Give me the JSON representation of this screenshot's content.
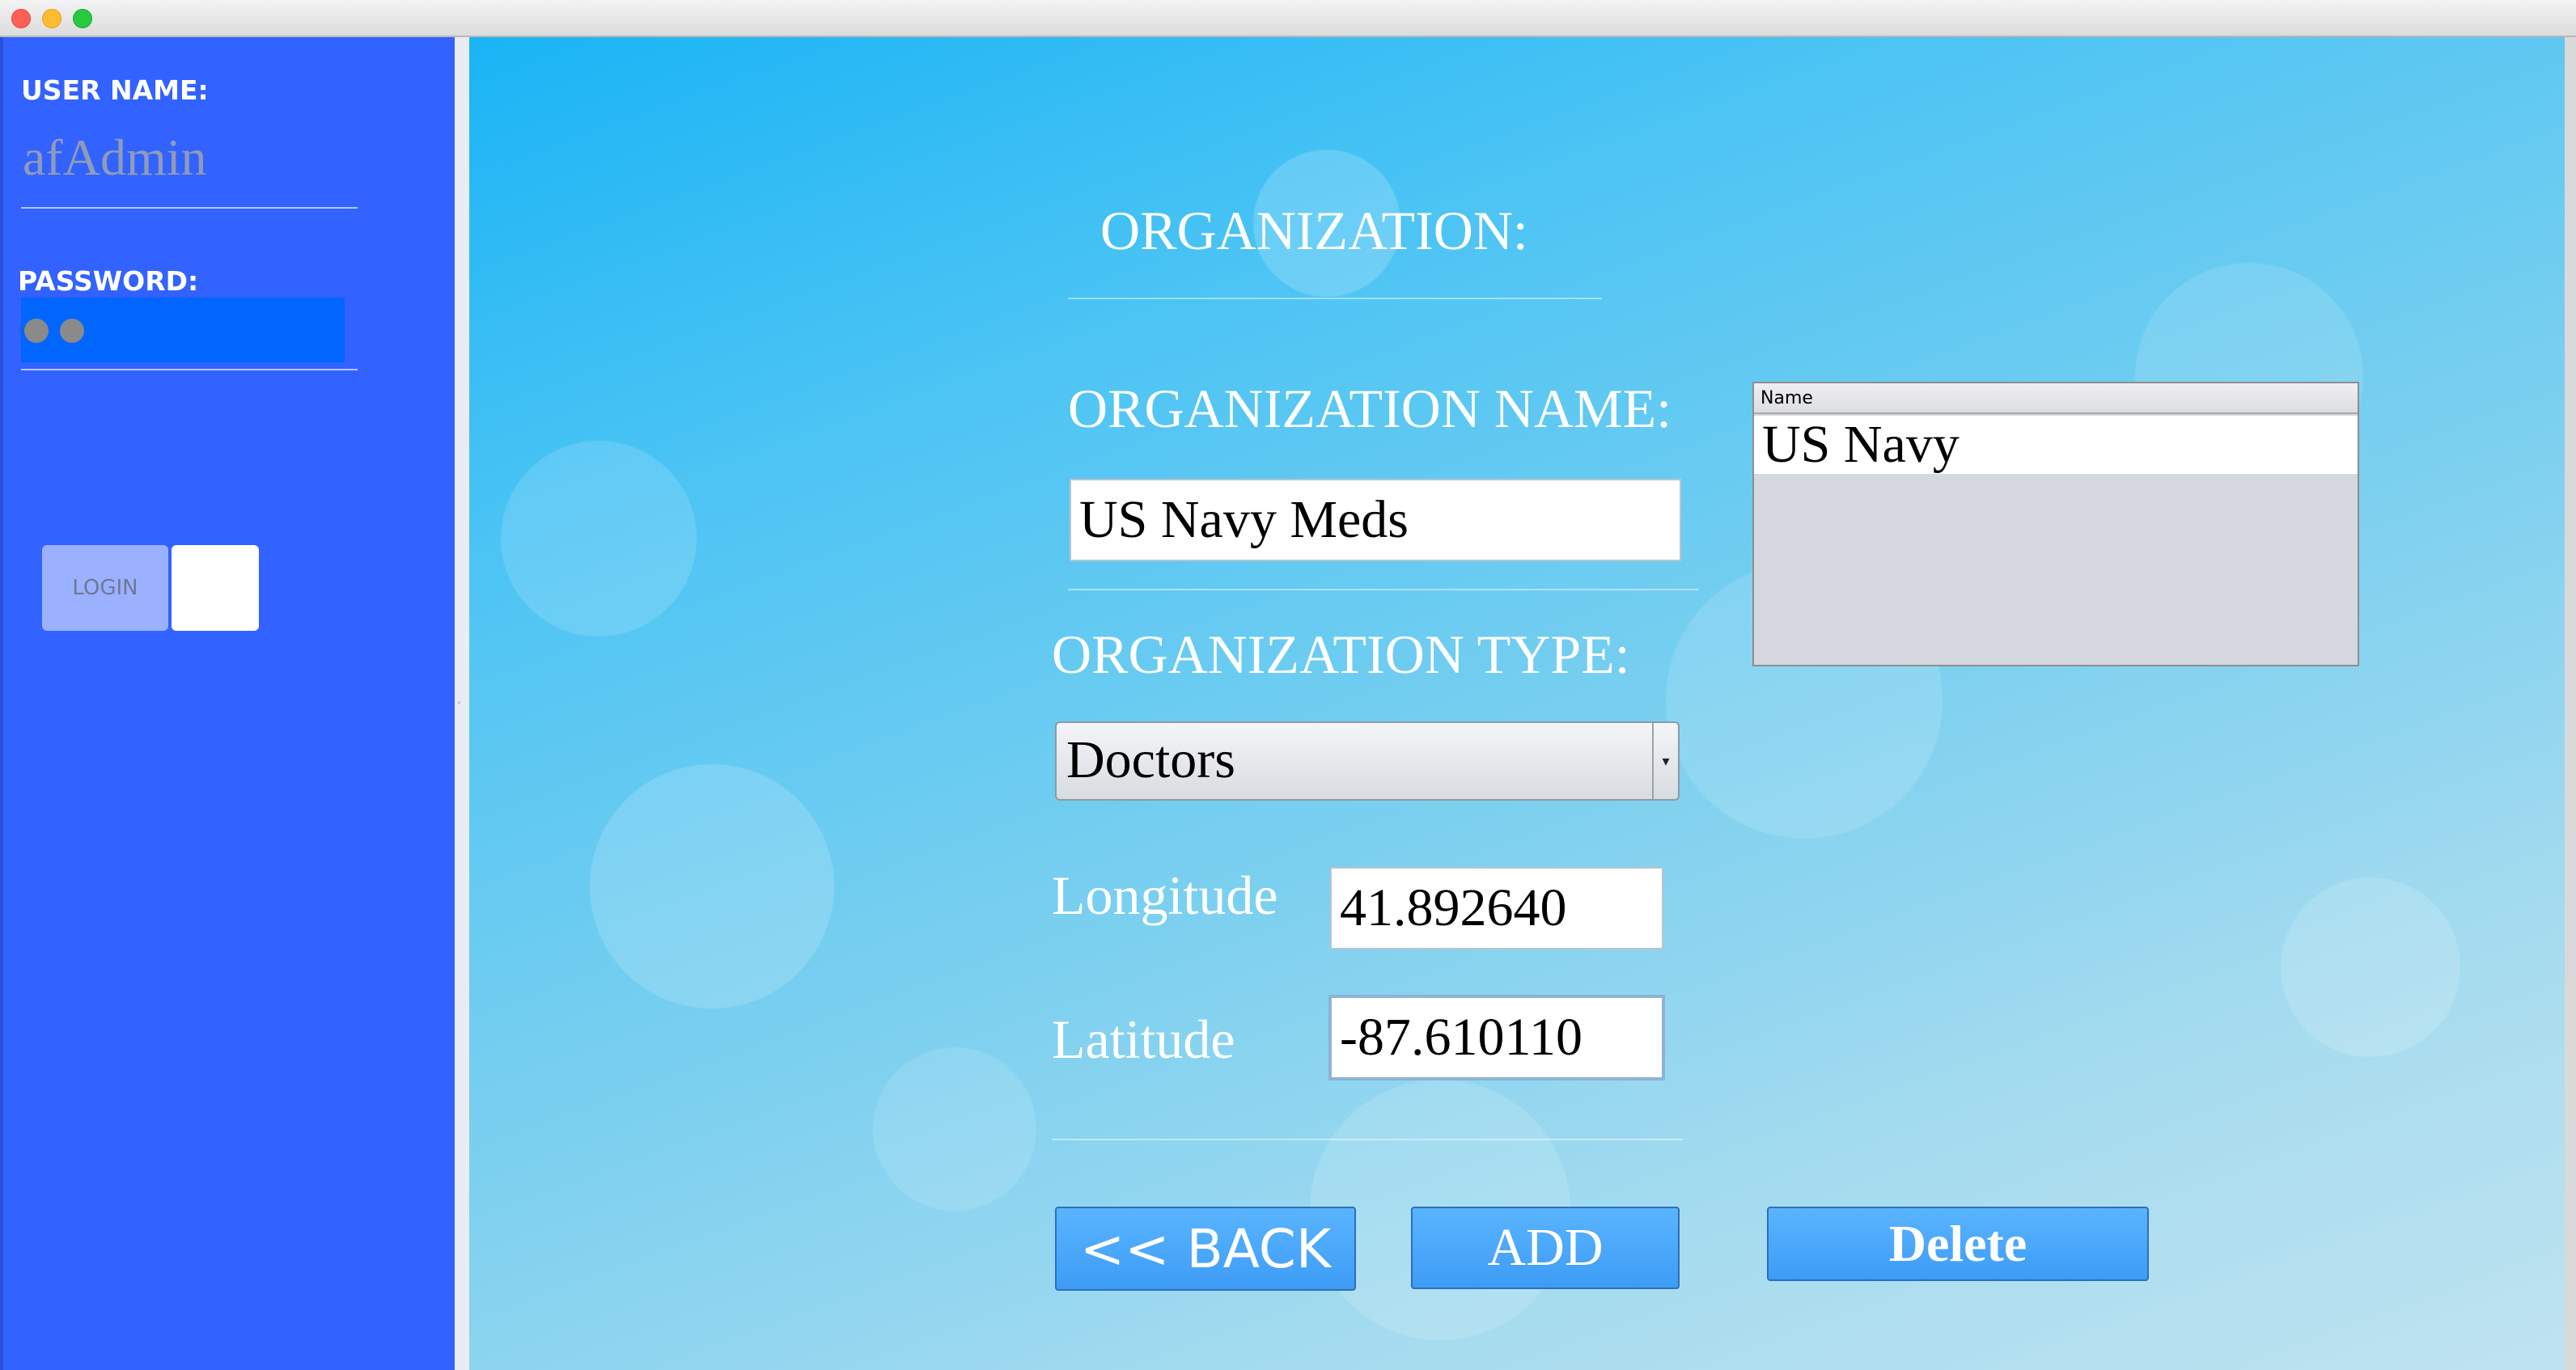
{
  "login_panel": {
    "username_label": "USER NAME:",
    "username_value": "afAdmin",
    "password_label": "PASSWORD:",
    "password_mask_count": 2,
    "login_button": "LOGIN"
  },
  "form": {
    "title": "ORGANIZATION:",
    "org_name_label": "ORGANIZATION NAME:",
    "org_name_value": "US Navy Meds",
    "org_type_label": "ORGANIZATION TYPE:",
    "org_type_selected": "Doctors",
    "longitude_label": "Longitude",
    "longitude_value": "41.892640",
    "latitude_label": "Latitude",
    "latitude_value": "-87.610110"
  },
  "organization_table": {
    "columns": [
      "Name"
    ],
    "rows": [
      [
        "US Navy"
      ]
    ]
  },
  "buttons": {
    "back": "<< BACK",
    "add": "ADD",
    "delete": "Delete"
  },
  "colors": {
    "sidebar": "#3262ff",
    "password_field": "#0066ff",
    "action_button": "#4aa8fb"
  }
}
